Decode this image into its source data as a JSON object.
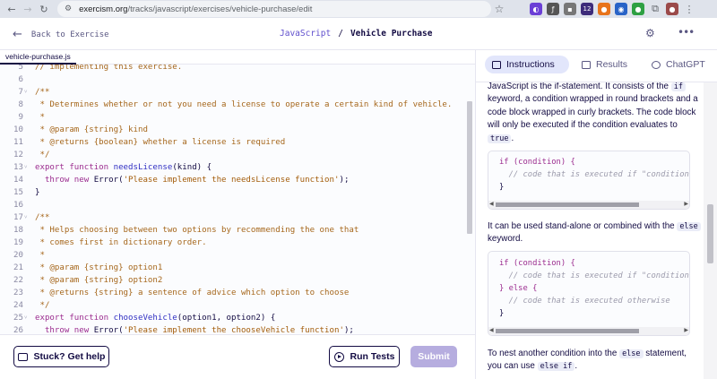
{
  "browser": {
    "url_host": "exercism.org",
    "url_path": "/tracks/javascript/exercises/vehicle-purchase/edit",
    "badge_count": "12"
  },
  "header": {
    "back_label": "Back to Exercise",
    "track": "JavaScript",
    "separator": "/",
    "exercise": "Vehicle Purchase"
  },
  "editor": {
    "file_tab": "vehicle-purchase.js",
    "lines": [
      {
        "n": "5",
        "fold": "",
        "parts": [
          {
            "c": "c-comment",
            "t": "// implementing this exercise."
          }
        ]
      },
      {
        "n": "6",
        "fold": "",
        "parts": []
      },
      {
        "n": "7",
        "fold": "v",
        "parts": [
          {
            "c": "c-comment",
            "t": "/**"
          }
        ]
      },
      {
        "n": "8",
        "fold": "",
        "parts": [
          {
            "c": "c-comment",
            "t": " * Determines whether or not you need a license to operate a certain kind of vehicle."
          }
        ]
      },
      {
        "n": "9",
        "fold": "",
        "parts": [
          {
            "c": "c-comment",
            "t": " *"
          }
        ]
      },
      {
        "n": "10",
        "fold": "",
        "parts": [
          {
            "c": "c-comment",
            "t": " * @param {string} kind"
          }
        ]
      },
      {
        "n": "11",
        "fold": "",
        "parts": [
          {
            "c": "c-comment",
            "t": " * @returns {boolean} whether a license is required"
          }
        ]
      },
      {
        "n": "12",
        "fold": "",
        "parts": [
          {
            "c": "c-comment",
            "t": " */"
          }
        ]
      },
      {
        "n": "13",
        "fold": "v",
        "parts": [
          {
            "c": "c-kw",
            "t": "export function "
          },
          {
            "c": "c-fn",
            "t": "needsLicense"
          },
          {
            "c": "c-plain",
            "t": "(kind) {"
          }
        ]
      },
      {
        "n": "14",
        "fold": "",
        "parts": [
          {
            "c": "c-kw",
            "t": "  throw new "
          },
          {
            "c": "c-plain",
            "t": "Error("
          },
          {
            "c": "c-str",
            "t": "'Please implement the needsLicense function'"
          },
          {
            "c": "c-plain",
            "t": ");"
          }
        ]
      },
      {
        "n": "15",
        "fold": "",
        "parts": [
          {
            "c": "c-plain",
            "t": "}"
          }
        ]
      },
      {
        "n": "16",
        "fold": "",
        "parts": []
      },
      {
        "n": "17",
        "fold": "v",
        "parts": [
          {
            "c": "c-comment",
            "t": "/**"
          }
        ]
      },
      {
        "n": "18",
        "fold": "",
        "parts": [
          {
            "c": "c-comment",
            "t": " * Helps choosing between two options by recommending the one that"
          }
        ]
      },
      {
        "n": "19",
        "fold": "",
        "parts": [
          {
            "c": "c-comment",
            "t": " * comes first in dictionary order."
          }
        ]
      },
      {
        "n": "20",
        "fold": "",
        "parts": [
          {
            "c": "c-comment",
            "t": " *"
          }
        ]
      },
      {
        "n": "21",
        "fold": "",
        "parts": [
          {
            "c": "c-comment",
            "t": " * @param {string} option1"
          }
        ]
      },
      {
        "n": "22",
        "fold": "",
        "parts": [
          {
            "c": "c-comment",
            "t": " * @param {string} option2"
          }
        ]
      },
      {
        "n": "23",
        "fold": "",
        "parts": [
          {
            "c": "c-comment",
            "t": " * @returns {string} a sentence of advice which option to choose"
          }
        ]
      },
      {
        "n": "24",
        "fold": "",
        "parts": [
          {
            "c": "c-comment",
            "t": " */"
          }
        ]
      },
      {
        "n": "25",
        "fold": "v",
        "parts": [
          {
            "c": "c-kw",
            "t": "export function "
          },
          {
            "c": "c-fn",
            "t": "chooseVehicle"
          },
          {
            "c": "c-plain",
            "t": "(option1, option2) {"
          }
        ]
      },
      {
        "n": "26",
        "fold": "",
        "parts": [
          {
            "c": "c-kw",
            "t": "  throw new "
          },
          {
            "c": "c-plain",
            "t": "Error("
          },
          {
            "c": "c-str",
            "t": "'Please implement the chooseVehicle function'"
          },
          {
            "c": "c-plain",
            "t": ");"
          }
        ]
      }
    ]
  },
  "actions": {
    "stuck_label": "Stuck? Get help",
    "run_label": "Run Tests",
    "submit_label": "Submit"
  },
  "panel": {
    "tabs": [
      "Instructions",
      "Results",
      "ChatGPT"
    ],
    "para1": {
      "a": "JavaScript is the if-statement. It consists of the ",
      "b": "if",
      "c": " keyword, a condition wrapped in round brackets and a code block wrapped in curly brackets. The code block will only be executed if the condition evaluates to ",
      "d": "true",
      "e": "."
    },
    "code1": [
      "if (condition) {",
      "  // code that is executed if \"condition",
      "}"
    ],
    "para2": {
      "a": "It can be used stand-alone or combined with the ",
      "b": "else",
      "c": " keyword."
    },
    "code2": [
      "if (condition) {",
      "  // code that is executed if \"condition",
      "} else {",
      "  // code that is executed otherwise",
      "}"
    ],
    "para3": {
      "a": "To nest another condition into the ",
      "b": "else",
      "c": " statement, you can use ",
      "d": "else if",
      "e": "."
    }
  }
}
